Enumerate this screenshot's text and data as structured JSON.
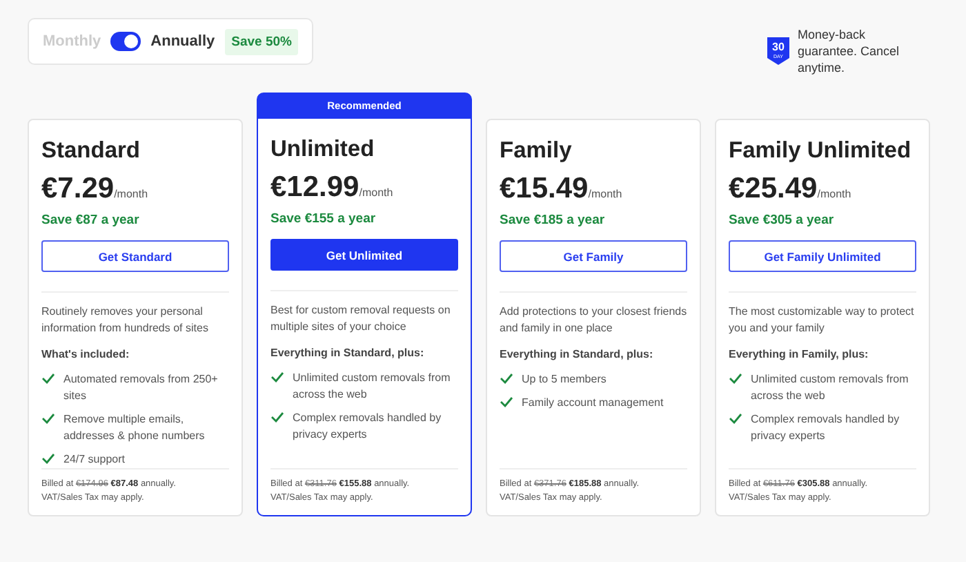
{
  "billing_toggle": {
    "left_label": "Monthly",
    "right_label": "Annually",
    "on": true,
    "badge": "Save 50%"
  },
  "guarantee": {
    "badge_number": "30",
    "badge_unit": "DAY",
    "text": "Money-back guarantee. Cancel anytime."
  },
  "plans": [
    {
      "name": "Standard",
      "recommended": false,
      "price": "€7.29",
      "period": "/month",
      "savings": "Save €87 a year",
      "button": "Get Standard",
      "description": "Routinely removes your personal information from hundreds of sites",
      "features_heading": "What's included:",
      "features": [
        "Automated removals from 250+ sites",
        "Remove multiple emails, addresses & phone numbers",
        "24/7 support"
      ],
      "billing": {
        "prefix": "Billed at",
        "old": "€174.96",
        "new": "€87.48",
        "suffix": "annually."
      },
      "tax": "VAT/Sales Tax may apply."
    },
    {
      "name": "Unlimited",
      "recommended": true,
      "ribbon": "Recommended",
      "price": "€12.99",
      "period": "/month",
      "savings": "Save €155 a year",
      "button": "Get Unlimited",
      "description": "Best for custom removal requests on multiple sites of your choice",
      "features_heading": "Everything in Standard, plus:",
      "features": [
        "Unlimited custom removals from across the web",
        "Complex removals handled by privacy experts"
      ],
      "billing": {
        "prefix": "Billed at",
        "old": "€311.76",
        "new": "€155.88",
        "suffix": "annually."
      },
      "tax": "VAT/Sales Tax may apply."
    },
    {
      "name": "Family",
      "recommended": false,
      "price": "€15.49",
      "period": "/month",
      "savings": "Save €185 a year",
      "button": "Get Family",
      "description": "Add protections to your closest friends and family in one place",
      "features_heading": "Everything in Standard, plus:",
      "features": [
        "Up to 5 members",
        "Family account management"
      ],
      "billing": {
        "prefix": "Billed at",
        "old": "€371.76",
        "new": "€185.88",
        "suffix": "annually."
      },
      "tax": "VAT/Sales Tax may apply."
    },
    {
      "name": "Family Unlimited",
      "recommended": false,
      "price": "€25.49",
      "period": "/month",
      "savings": "Save €305 a year",
      "button": "Get Family Unlimited",
      "description": "The most customizable way to protect you and your family",
      "features_heading": "Everything in Family, plus:",
      "features": [
        "Unlimited custom removals from across the web",
        "Complex removals handled by privacy experts"
      ],
      "billing": {
        "prefix": "Billed at",
        "old": "€611.76",
        "new": "€305.88",
        "suffix": "annually."
      },
      "tax": "VAT/Sales Tax may apply."
    }
  ]
}
